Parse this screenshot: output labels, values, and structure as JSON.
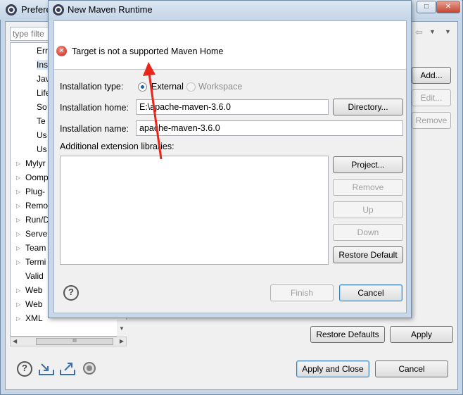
{
  "preferences": {
    "title": "Prefere",
    "filter_placeholder": "type filte",
    "tree_items": [
      {
        "label": "Err",
        "indent": 2,
        "selected": false,
        "expandable": false
      },
      {
        "label": "Ins",
        "indent": 2,
        "selected": true,
        "expandable": false
      },
      {
        "label": "Jav",
        "indent": 2,
        "selected": false,
        "expandable": false
      },
      {
        "label": "Life",
        "indent": 2,
        "selected": false,
        "expandable": false
      },
      {
        "label": "So",
        "indent": 2,
        "selected": false,
        "expandable": false
      },
      {
        "label": "Te",
        "indent": 2,
        "selected": false,
        "expandable": false
      },
      {
        "label": "Us",
        "indent": 2,
        "selected": false,
        "expandable": false
      },
      {
        "label": "Us",
        "indent": 2,
        "selected": false,
        "expandable": false
      },
      {
        "label": "Mylyr",
        "indent": 1,
        "selected": false,
        "expandable": true
      },
      {
        "label": "Oomp",
        "indent": 1,
        "selected": false,
        "expandable": true
      },
      {
        "label": "Plug-",
        "indent": 1,
        "selected": false,
        "expandable": true
      },
      {
        "label": "Remo",
        "indent": 1,
        "selected": false,
        "expandable": true
      },
      {
        "label": "Run/D",
        "indent": 1,
        "selected": false,
        "expandable": true
      },
      {
        "label": "Serve",
        "indent": 1,
        "selected": false,
        "expandable": true
      },
      {
        "label": "Team",
        "indent": 1,
        "selected": false,
        "expandable": true
      },
      {
        "label": "Termi",
        "indent": 1,
        "selected": false,
        "expandable": true
      },
      {
        "label": "Valid",
        "indent": 1,
        "selected": false,
        "expandable": false
      },
      {
        "label": "Web",
        "indent": 1,
        "selected": false,
        "expandable": true
      },
      {
        "label": "Web",
        "indent": 1,
        "selected": false,
        "expandable": true
      },
      {
        "label": "XML",
        "indent": 1,
        "selected": false,
        "expandable": true
      }
    ],
    "hscroll_grip": "III",
    "add_button": "Add...",
    "edit_button": "Edit...",
    "remove_button": "Remove",
    "restore_defaults_button": "Restore Defaults",
    "apply_button": "Apply",
    "apply_close_button": "Apply and Close",
    "cancel_button": "Cancel"
  },
  "dialog": {
    "title": "New Maven Runtime",
    "error_message": "Target is not a supported Maven Home",
    "installation_type_label": "Installation type:",
    "external_label": "External",
    "workspace_label": "Workspace",
    "installation_home_label": "Installation home:",
    "installation_home_value": "E:\\apache-maven-3.6.0",
    "directory_button": "Directory...",
    "installation_name_label": "Installation name:",
    "installation_name_value": "apache-maven-3.6.0",
    "extension_libraries_label": "Additional extension libraries:",
    "project_button": "Project...",
    "remove_button": "Remove",
    "up_button": "Up",
    "down_button": "Down",
    "restore_default_button": "Restore Default",
    "finish_button": "Finish",
    "cancel_button": "Cancel",
    "help_symbol": "?"
  },
  "annotation": {
    "arrow_color": "#e8261a"
  }
}
